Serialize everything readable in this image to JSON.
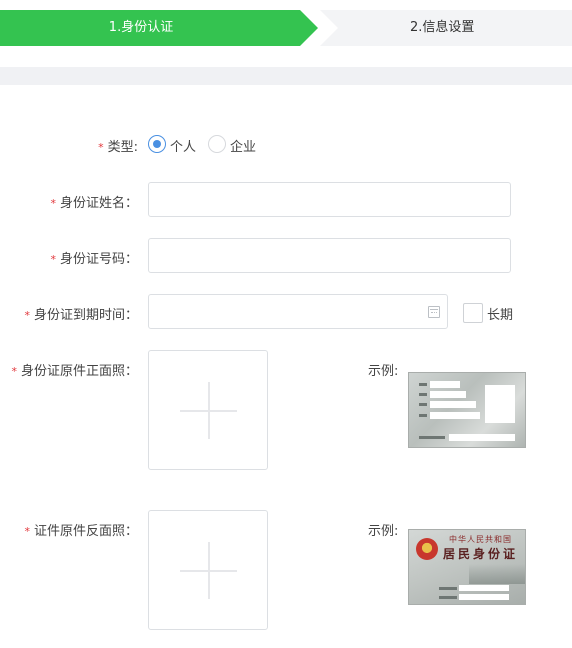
{
  "stepper": {
    "step1": "1.身份认证",
    "step2": "2.信息设置"
  },
  "colors": {
    "active_step": "#34c350",
    "required": "#e2373c",
    "radio_accent": "#4a90e2"
  },
  "form": {
    "required_mark": "*",
    "type": {
      "label": "类型:",
      "options": [
        "个人",
        "企业"
      ],
      "selected": "个人"
    },
    "id_name": {
      "label": "身份证姓名：",
      "value": ""
    },
    "id_number": {
      "label": "身份证号码：",
      "value": ""
    },
    "id_expiry": {
      "label": "身份证到期时间：",
      "value": "",
      "long_term_label": "长期",
      "long_term_checked": false
    },
    "id_front": {
      "label": "身份证原件正面照：",
      "example_label": "示例:"
    },
    "id_back": {
      "label": "证件原件反面照：",
      "example_label": "示例:"
    }
  },
  "sample_cards": {
    "back_title_line1": "中华人民共和国",
    "back_title_line2": "居民身份证"
  },
  "icons": {
    "date_picker": "calendar-icon",
    "upload": "plus-icon",
    "back_emblem": "national-emblem-icon"
  }
}
